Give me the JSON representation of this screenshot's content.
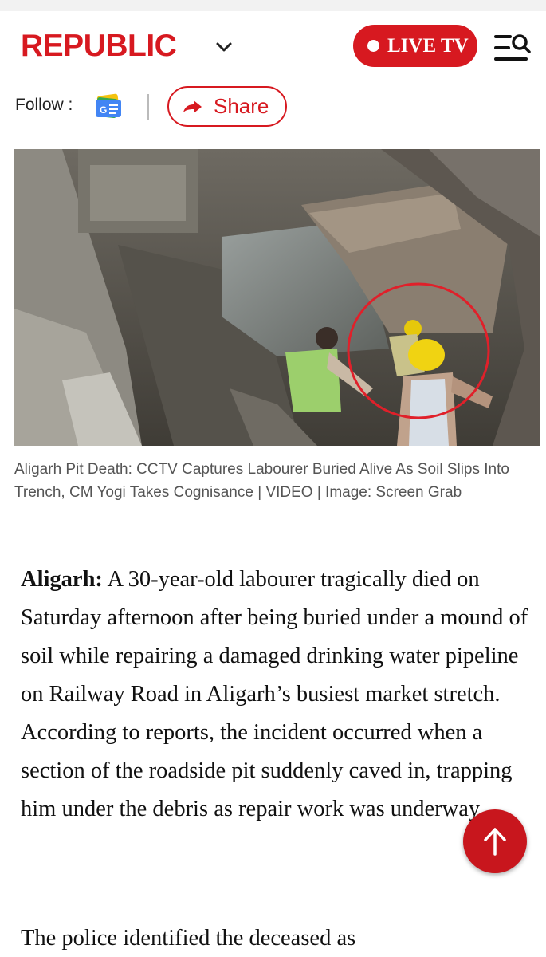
{
  "header": {
    "logo_text": "REPUBLIC",
    "live_label": "LIVE TV",
    "brand_color": "#d71920"
  },
  "icons": [
    "chevron-down-icon",
    "live-dot-icon",
    "menu-search-icon",
    "google-news-icon",
    "share-arrow-icon",
    "arrow-up-icon"
  ],
  "follow": {
    "label": "Follow :",
    "share_label": "Share"
  },
  "hero": {
    "caption": "Aligarh Pit Death: CCTV Captures Labourer Buried Alive As Soil Slips Into Trench, CM Yogi Takes Cognisance | VIDEO | Image: Screen Grab"
  },
  "article": {
    "dateline": "Aligarh:",
    "paragraph_1": " A 30-year-old labourer tragically died on Saturday afternoon after being buried under a mound of soil while repairing a damaged drinking water pipeline on Railway Road in Aligarh’s busiest market stretch. According to reports, the incident occurred when a section of the roadside pit suddenly caved in, trapping him under the debris as repair work was underway.",
    "paragraph_2": "The police identified the deceased as"
  }
}
